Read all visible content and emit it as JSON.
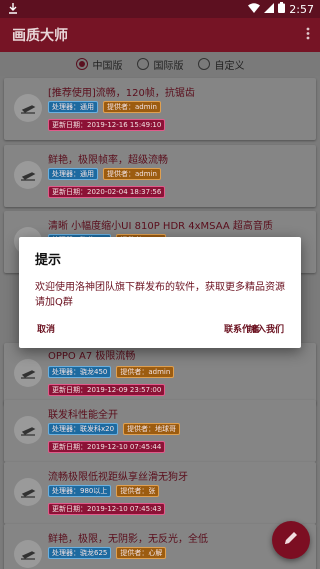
{
  "status_bar": {
    "time": "2:57",
    "left_icon": "download-icon",
    "right_icons": [
      "wifi-icon",
      "signal-icon",
      "battery-icon"
    ]
  },
  "app_bar": {
    "title": "画质大师",
    "menu_icon": "more-vert-icon"
  },
  "radio_group": {
    "selected": 0,
    "options": [
      {
        "label": "中国版"
      },
      {
        "label": "国际版"
      },
      {
        "label": "自定义"
      }
    ]
  },
  "cards": [
    {
      "title": "[推荐使用]流畅，120帧，抗锯齿",
      "processor": "处理器：通用",
      "provider": "提供者：admin",
      "date": "更新日期：2019-12-16 15:49:10"
    },
    {
      "title": "鲜艳，极限帧率，超级流畅",
      "processor": "处理器：通用",
      "provider": "提供者：admin",
      "date": "更新日期：2020-02-04 18:37:56"
    },
    {
      "title": "清晰 小幅度缩小UI 810P HDR 4xMSAA 超高音质",
      "processor": "处理器：骁龙855",
      "provider": "提供者：test",
      "date": ""
    },
    {
      "title": "OPPO A7 极限流畅",
      "processor": "处理器：骁龙450",
      "provider": "提供者：admin",
      "date": "更新日期：2019-12-09 23:57:00"
    },
    {
      "title": "联发科性能全开",
      "processor": "处理器：联发科x20",
      "provider": "提供者：地球哥",
      "date": "更新日期：2019-12-10 07:45:44"
    },
    {
      "title": "流畅极限低视距纵享丝滑无狗牙",
      "processor": "处理器：980以上",
      "provider": "提供者：张",
      "date": "更新日期：2019-12-10 07:45:43"
    },
    {
      "title": "鲜艳，极限，无阴影，无反光，全低",
      "processor": "处理器：骁龙625",
      "provider": "提供者：心解",
      "date": ""
    }
  ],
  "dialog": {
    "title": "提示",
    "message": "欢迎使用洛神团队旗下群发布的软件，获取更多精品资源请加Q群",
    "cancel_label": "取消",
    "contact_label": "联系作者",
    "join_label": "加入我们"
  },
  "fab": {
    "icon": "edit-icon"
  },
  "colors": {
    "primary": "#761425",
    "status_bar": "#5d1020",
    "accent": "#6b1220"
  }
}
